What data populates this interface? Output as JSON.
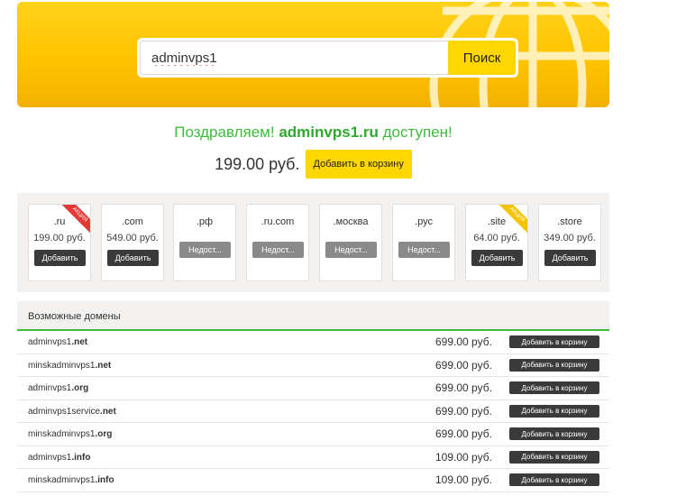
{
  "search": {
    "query": "adminvps1",
    "button_label": "Поиск"
  },
  "result": {
    "congrats_prefix": "Поздравляем!",
    "domain": "adminvps1.ru",
    "congrats_suffix": "доступен!",
    "price": "199.00 руб.",
    "add_label": "Добавить в корзину"
  },
  "zones": [
    {
      "name": ".ru",
      "price": "199.00 руб.",
      "button": "Добавить",
      "available": true,
      "ribbon": "АКЦИЯ"
    },
    {
      "name": ".com",
      "price": "549.00 руб.",
      "button": "Добавить",
      "available": true,
      "ribbon": ""
    },
    {
      "name": ".рф",
      "price": "",
      "button": "Недост...",
      "available": false,
      "ribbon": ""
    },
    {
      "name": ".ru.com",
      "price": "",
      "button": "Недост...",
      "available": false,
      "ribbon": ""
    },
    {
      "name": ".москва",
      "price": "",
      "button": "Недост...",
      "available": false,
      "ribbon": ""
    },
    {
      "name": ".рус",
      "price": "",
      "button": "Недост...",
      "available": false,
      "ribbon": ""
    },
    {
      "name": ".site",
      "price": "64.00 руб.",
      "button": "Добавить",
      "available": true,
      "ribbon": "АКЦИЯ"
    },
    {
      "name": ".store",
      "price": "349.00 руб.",
      "button": "Добавить",
      "available": true,
      "ribbon": ""
    }
  ],
  "possible": {
    "heading": "Возможные домены",
    "rows": [
      {
        "base": "adminvps1",
        "tld": ".net",
        "price": "699.00 руб.",
        "button": "Добавить в корзину"
      },
      {
        "base": "minskadminvps1",
        "tld": ".net",
        "price": "699.00 руб.",
        "button": "Добавить в корзину"
      },
      {
        "base": "adminvps1",
        "tld": ".org",
        "price": "699.00 руб.",
        "button": "Добавить в корзину"
      },
      {
        "base": "adminvps1service",
        "tld": ".net",
        "price": "699.00 руб.",
        "button": "Добавить в корзину"
      },
      {
        "base": "minskadminvps1",
        "tld": ".org",
        "price": "699.00 руб.",
        "button": "Добавить в корзину"
      },
      {
        "base": "adminvps1",
        "tld": ".info",
        "price": "109.00 руб.",
        "button": "Добавить в корзину"
      },
      {
        "base": "minskadminvps1",
        "tld": ".info",
        "price": "109.00 руб.",
        "button": "Добавить в корзину"
      }
    ]
  },
  "colors": {
    "banner_yellow": "#ffc400",
    "accent_green": "#3dbb3d",
    "button_yellow": "#ffd700",
    "button_dark": "#3a3a3a",
    "button_disabled": "#8a8a8a",
    "ribbon_red": "#e53935",
    "ribbon_yellow": "#f5c400"
  }
}
